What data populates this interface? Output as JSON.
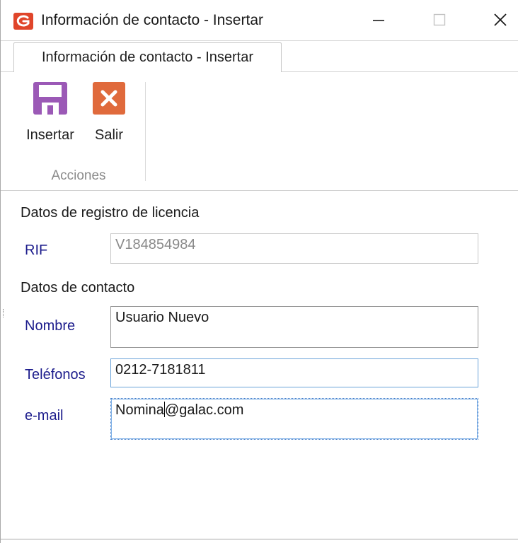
{
  "window": {
    "title": "Información de contacto - Insertar",
    "icon": "galac-logo-icon",
    "controls": {
      "minimize": "minimize-icon",
      "maximize": "maximize-icon",
      "close": "close-icon"
    }
  },
  "ribbon": {
    "tabs": [
      {
        "label": "Información de contacto - Insertar",
        "active": true
      }
    ],
    "groups": [
      {
        "label": "Acciones",
        "buttons": [
          {
            "label": "Insertar",
            "icon": "save-icon",
            "color": "#9b59b6"
          },
          {
            "label": "Salir",
            "icon": "close-icon",
            "color": "#e06a3c"
          }
        ]
      }
    ]
  },
  "form": {
    "license_section": {
      "title": "Datos de registro de licencia",
      "rif": {
        "label": "RIF",
        "value": "V184854984"
      }
    },
    "contact_section": {
      "title": "Datos de contacto",
      "nombre": {
        "label": "Nombre",
        "value": "Usuario Nuevo"
      },
      "telefonos": {
        "label": "Teléfonos",
        "value": "0212-7181811"
      },
      "email": {
        "label": "e-mail",
        "value_before_caret": "Nomina",
        "value_after_caret": "@galac.com"
      }
    }
  },
  "colors": {
    "label_text": "#1c1c8c",
    "focus_border": "#3a78c8",
    "disabled_text": "#8a8a8a",
    "logo_red": "#e0452a"
  }
}
